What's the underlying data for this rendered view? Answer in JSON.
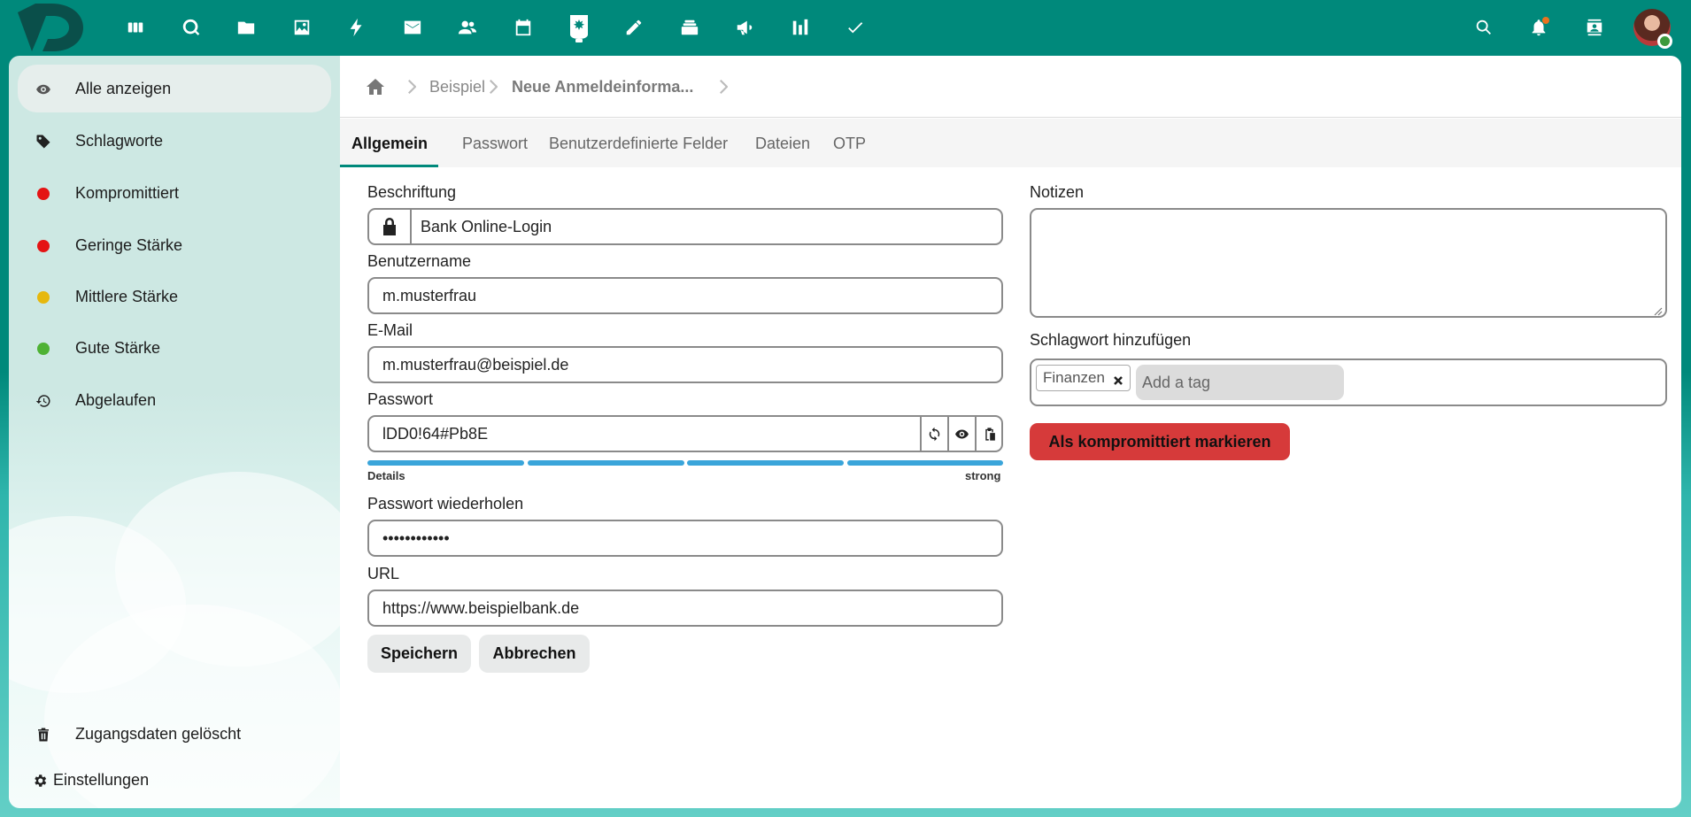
{
  "colors": {
    "accent": "#00897b",
    "danger": "#d63a3a",
    "strength": "#3aa5da",
    "red_dot": "#e41414",
    "yellow_dot": "#e6b80e",
    "green_dot": "#4eb234"
  },
  "topbar": {
    "apps": [
      "dashboard-icon",
      "search-q-icon",
      "files-icon",
      "photos-icon",
      "activity-icon",
      "mail-icon",
      "contacts-icon",
      "calendar-icon",
      "passwords-icon",
      "notes-icon",
      "deck-icon",
      "announcements-icon",
      "analytics-icon",
      "tasks-icon"
    ],
    "right": [
      "search-icon",
      "notifications-icon",
      "contacts-menu-icon",
      "avatar"
    ]
  },
  "sidebar": {
    "items": [
      {
        "label": "Alle anzeigen",
        "icon": "eye-icon"
      },
      {
        "label": "Schlagworte",
        "icon": "tag-icon"
      },
      {
        "label": "Kompromittiert",
        "icon": "red-dot"
      },
      {
        "label": "Geringe Stärke",
        "icon": "red-dot"
      },
      {
        "label": "Mittlere Stärke",
        "icon": "yellow-dot"
      },
      {
        "label": "Gute Stärke",
        "icon": "green-dot"
      },
      {
        "label": "Abgelaufen",
        "icon": "history-icon"
      }
    ],
    "deleted_label": "Zugangsdaten gelöscht",
    "settings_label": "Einstellungen"
  },
  "breadcrumb": {
    "items": [
      "Beispiel",
      "Neue Anmeldeinforma..."
    ]
  },
  "tabs": [
    "Allgemein",
    "Passwort",
    "Benutzerdefinierte Felder",
    "Dateien",
    "OTP"
  ],
  "form": {
    "label_caption": "Beschriftung",
    "caption_value": "Bank Online-Login",
    "label_username": "Benutzername",
    "username_value": "m.musterfrau",
    "label_email": "E-Mail",
    "email_value": "m.musterfrau@beispiel.de",
    "label_password": "Passwort",
    "password_value": "lDD0!64#Pb8E",
    "strength_details": "Details",
    "strength_level": "strong",
    "strength_fraction": 1.0,
    "label_repeat": "Passwort wiederholen",
    "repeat_value": "••••••••••••",
    "label_url": "URL",
    "url_value": "https://www.beispielbank.de",
    "save_label": "Speichern",
    "cancel_label": "Abbrechen"
  },
  "right": {
    "label_notes": "Notizen",
    "notes_value": "",
    "label_tags": "Schlagwort hinzufügen",
    "tags": [
      "Finanzen"
    ],
    "tag_placeholder": "Add a tag",
    "compromised_label": "Als kompromittiert markieren"
  }
}
